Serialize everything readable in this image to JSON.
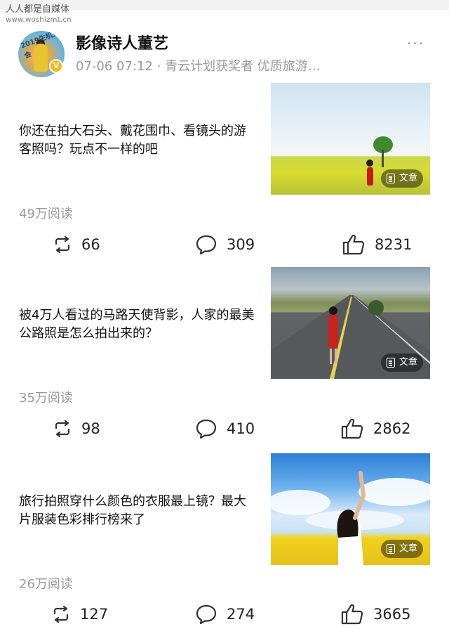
{
  "watermark": {
    "site_name": "人人都是自媒体",
    "url": "www.woshizmt.cn"
  },
  "header": {
    "author_name": "影像诗人董艺",
    "meta": "07-06 07:12 · 青云计划获奖者 优质旅游…",
    "avatar_ring_text": "2019生机大会",
    "verified_badge": "V",
    "more_label": "···"
  },
  "posts": [
    {
      "title": "你还在拍大石头、戴花围巾、看镜头的游客照吗？玩点不一样的吧",
      "thumb_tag": "文章",
      "reads": "49万阅读",
      "shares": "66",
      "comments": "309",
      "likes": "8231"
    },
    {
      "title": "被4万人看过的马路天使背影，人家的最美公路照是怎么拍出来的？",
      "thumb_tag": "文章",
      "reads": "35万阅读",
      "shares": "98",
      "comments": "410",
      "likes": "2862"
    },
    {
      "title": "旅行拍照穿什么颜色的衣服最上镜？最大片服装色彩排行榜来了",
      "thumb_tag": "文章",
      "reads": "26万阅读",
      "shares": "127",
      "comments": "274",
      "likes": "3665"
    }
  ],
  "icons": {
    "share": "repost-icon",
    "comment": "comment-bubble-icon",
    "like": "thumbs-up-icon",
    "tag": "document-icon"
  }
}
